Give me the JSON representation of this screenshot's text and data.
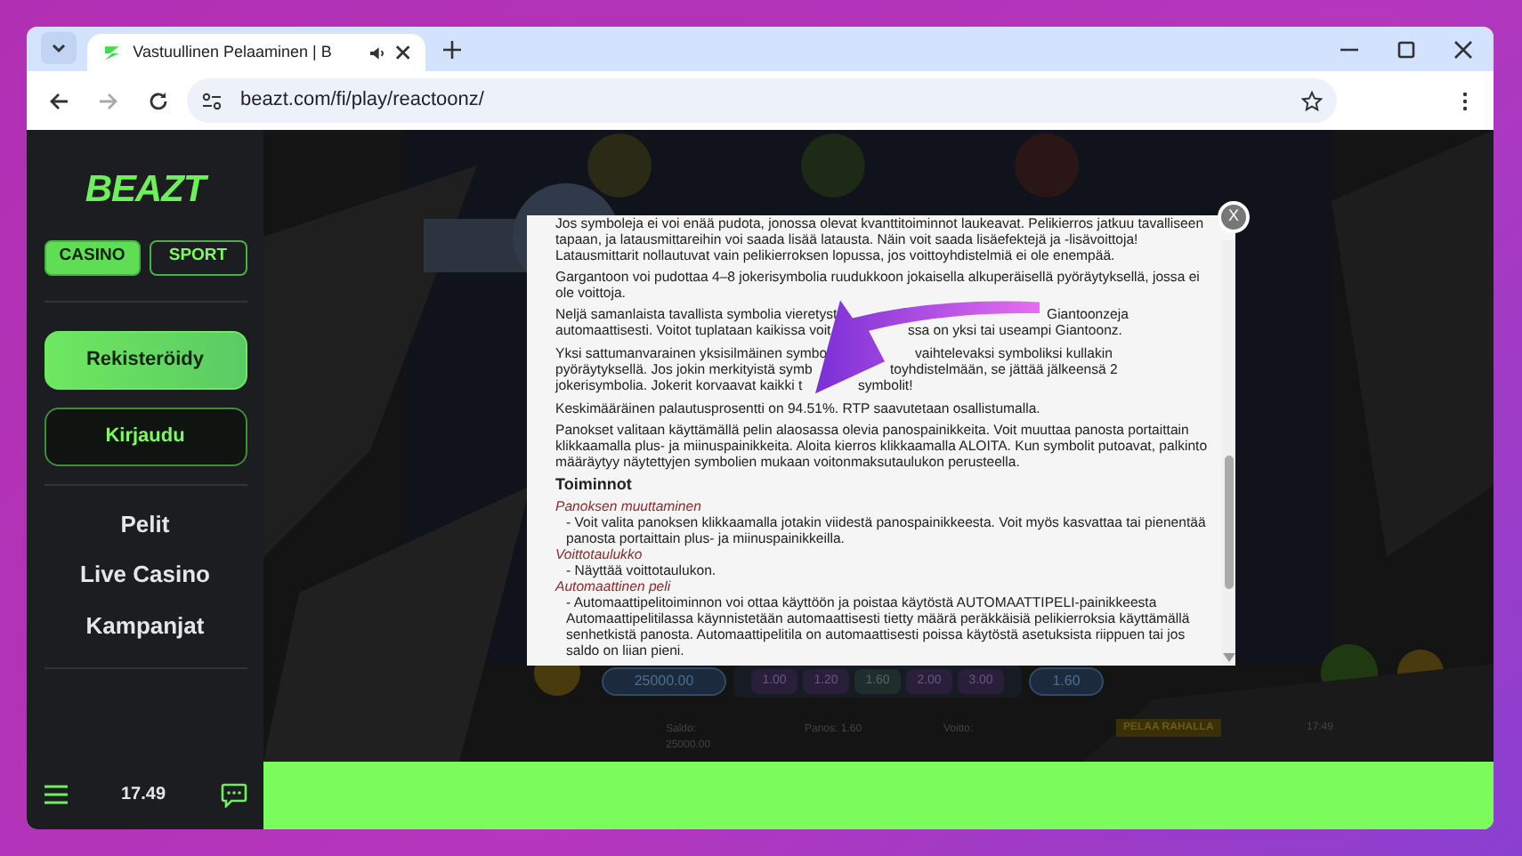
{
  "browser": {
    "tabs": [
      {
        "title": "Vastuullinen Pelaaminen | B",
        "selected": true,
        "audio": true
      }
    ],
    "url": "beazt.com/fi/play/reactoonz/"
  },
  "sidebar": {
    "logo": "BEAZT",
    "segments": [
      {
        "label": "CASINO",
        "selected": true
      },
      {
        "label": "SPORT",
        "selected": false
      }
    ],
    "buttons": [
      {
        "label": "Rekisteröidy",
        "kind": "primary"
      },
      {
        "label": "Kirjaudu",
        "kind": "outline"
      }
    ],
    "nav": [
      "Pelit",
      "Live Casino",
      "Kampanjat"
    ],
    "time": "17.49"
  },
  "game": {
    "balance_field": "25000.00",
    "bets": [
      {
        "label": "1.00",
        "selected": false
      },
      {
        "label": "1.20",
        "selected": false
      },
      {
        "label": "1.60",
        "selected": true
      },
      {
        "label": "2.00",
        "selected": false
      },
      {
        "label": "3.00",
        "selected": false
      }
    ],
    "bet_field": "1.60",
    "status": [
      "Saldo: 25000.00",
      "Panos: 1.60",
      "Voitto:"
    ],
    "real_play": "PELAA RAHALLA",
    "clock": "17:49"
  },
  "dialog": {
    "close": "X",
    "blocks": [
      {
        "kind": "paragraph",
        "text": "Jos symboleja ei voi enää pudota, jonossa olevat kvanttitoiminnot laukeavat. Pelikierros jatkuu tavalliseen tapaan, ja latausmittareihin voi saada lisää latausta. Näin voit saada lisäefektejä ja -lisävoittoja! Latausmittarit nollautuvat vain pelikierroksen lopussa, jos voittoyhdistelmiä ei ole enempää."
      },
      {
        "kind": "paragraph",
        "text": "Gargantoon voi pudottaa 4–8 jokerisymbolia ruudukkoon jokaisella alkuperäisellä pyöräytyksellä, jossa ei ole voittoja."
      },
      {
        "kind": "covered",
        "lines": [
          [
            "Neljä samanlaista tavallista symbolia vieretyst",
            "Giantoonzeja"
          ],
          [
            "automaattisesti. Voitot tuplataan kaikissa voit",
            "ssa on yksi tai useampi Giantoonz."
          ]
        ]
      },
      {
        "kind": "covered",
        "lines": [
          [
            "Yksi sattumanvarainen yksisilmäinen symbo",
            "vaihtelevaksi symboliksi kullakin"
          ],
          [
            "pyöräytyksellä. Jos jokin merkityistä symb",
            "toyhdistelmään, se jättää jälkeensä 2"
          ],
          [
            "jokerisymbolia. Jokerit korvaavat kaikki t",
            "symbolit!"
          ]
        ]
      },
      {
        "kind": "paragraph",
        "text": "Keskimääräinen palautusprosentti on 94.51%. RTP saavutetaan osallistumalla."
      },
      {
        "kind": "paragraph",
        "text": "Panokset valitaan käyttämällä pelin alaosassa olevia panospainikkeita. Voit muuttaa panosta portaittain klikkaamalla plus- ja miinuspainikkeita. Aloita kierros klikkaamalla ALOITA. Kun symbolit putoavat, palkinto määräytyy näytettyjen symbolien mukaan voitonmaksutaulukon perusteella."
      },
      {
        "kind": "heading",
        "text": "Toiminnot"
      },
      {
        "kind": "term",
        "text": "Panoksen muuttaminen"
      },
      {
        "kind": "description",
        "text": "- Voit valita panoksen klikkaamalla jotakin viidestä panospainikkeesta. Voit myös kasvattaa tai pienentää panosta portaittain plus- ja miinuspainikkeilla."
      },
      {
        "kind": "term",
        "text": "Voittotaulukko"
      },
      {
        "kind": "description",
        "text": "- Näyttää voittotaulukon."
      },
      {
        "kind": "term",
        "text": "Automaattinen peli"
      },
      {
        "kind": "description",
        "text": "- Automaattipelitoiminnon voi ottaa käyttöön ja poistaa käytöstä AUTOMAATTIPELI-painikkeesta Automaattipelitilassa käynnistetään automaattisesti tietty määrä peräkkäisiä pelikierroksia käyttämällä senhetkistä panosta. Automaattipelitila on automaattisesti poissa käytöstä asetuksista riippuen tai jos saldo on liian pieni."
      }
    ]
  }
}
